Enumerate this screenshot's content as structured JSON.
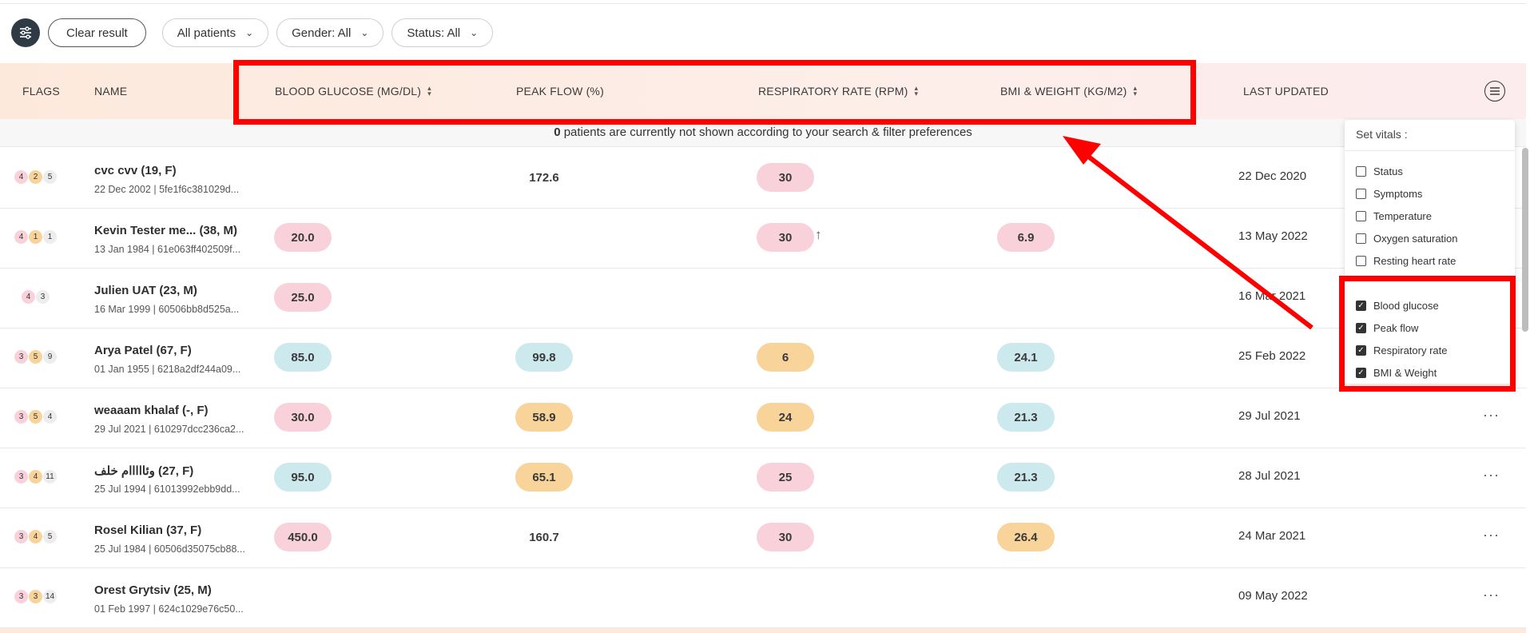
{
  "toolbar": {
    "clear_label": "Clear result",
    "patients_filter": "All patients",
    "gender_filter": "Gender: All",
    "status_filter": "Status: All"
  },
  "columns": {
    "flags": "FLAGS",
    "name": "NAME",
    "blood_glucose": "BLOOD GLUCOSE (MG/DL)",
    "peak_flow": "PEAK FLOW (%)",
    "respiratory_rate": "RESPIRATORY RATE (RPM)",
    "bmi_weight": "BMI & WEIGHT (KG/M2)",
    "last_updated": "LAST UPDATED"
  },
  "notice": {
    "count": "0",
    "text": "patients are currently not shown according to your search & filter preferences"
  },
  "rows": [
    {
      "flags": [
        "4",
        "2",
        "5"
      ],
      "name": "cvc cvv (19, F)",
      "sub": "22 Dec 2002 | 5fe1f6c381029d...",
      "glucose": "",
      "peak": "172.6",
      "resp": "30",
      "bmi": "",
      "updated": "22 Dec 2020"
    },
    {
      "flags": [
        "4",
        "1",
        "1"
      ],
      "name": "Kevin Tester me... (38, M)",
      "sub": "13 Jan 1984 | 61e063ff402509f...",
      "glucose": "20.0",
      "peak": "",
      "resp": "30",
      "bmi": "6.9",
      "updated": "13 May 2022"
    },
    {
      "flags": [
        "4",
        "3"
      ],
      "name": "Julien UAT (23, M)",
      "sub": "16 Mar 1999 | 60506bb8d525a...",
      "glucose": "25.0",
      "peak": "",
      "resp": "",
      "bmi": "",
      "updated": "16 Mar 2021"
    },
    {
      "flags": [
        "3",
        "5",
        "9"
      ],
      "name": "Arya Patel (67, F)",
      "sub": "01 Jan 1955 | 6218a2df244a09...",
      "glucose": "85.0",
      "peak": "99.8",
      "resp": "6",
      "bmi": "24.1",
      "updated": "25 Feb 2022"
    },
    {
      "flags": [
        "3",
        "5",
        "4"
      ],
      "name": "weaaam khalaf (-, F)",
      "sub": "29 Jul 2021 | 610297dcc236ca2...",
      "glucose": "30.0",
      "peak": "58.9",
      "resp": "24",
      "bmi": "21.3",
      "updated": "29 Jul 2021"
    },
    {
      "flags": [
        "3",
        "4",
        "11"
      ],
      "name": "وئااااام خلف (27, F)",
      "sub": "25 Jul 1994 | 61013992ebb9dd...",
      "glucose": "95.0",
      "peak": "65.1",
      "resp": "25",
      "bmi": "21.3",
      "updated": "28 Jul 2021"
    },
    {
      "flags": [
        "3",
        "4",
        "5"
      ],
      "name": "Rosel Kilian (37, F)",
      "sub": "25 Jul 1984 | 60506d35075cb88...",
      "glucose": "450.0",
      "peak": "160.7",
      "resp": "30",
      "bmi": "26.4",
      "updated": "24 Mar 2021"
    },
    {
      "flags": [
        "3",
        "3",
        "14"
      ],
      "name": "Orest Grytsiv (25, M)",
      "sub": "01 Feb 1997 | 624c1029e76c50...",
      "glucose": "",
      "peak": "",
      "resp": "",
      "bmi": "",
      "updated": "09 May 2022"
    }
  ],
  "vitals_panel": {
    "title": "Set vitals :",
    "items": [
      {
        "label": "Status",
        "checked": false
      },
      {
        "label": "Symptoms",
        "checked": false
      },
      {
        "label": "Temperature",
        "checked": false
      },
      {
        "label": "Oxygen saturation",
        "checked": false
      },
      {
        "label": "Resting heart rate",
        "checked": false
      },
      {
        "label": "Blood glucose",
        "checked": true
      },
      {
        "label": "Peak flow",
        "checked": true
      },
      {
        "label": "Respiratory rate",
        "checked": true
      },
      {
        "label": "BMI & Weight",
        "checked": true
      }
    ]
  },
  "colors": {
    "annotation": "#ff0000",
    "pink": "#f9d1db",
    "orange": "#f8d39a",
    "blue": "#cce9ee",
    "header_bg": "#fde9dc"
  }
}
